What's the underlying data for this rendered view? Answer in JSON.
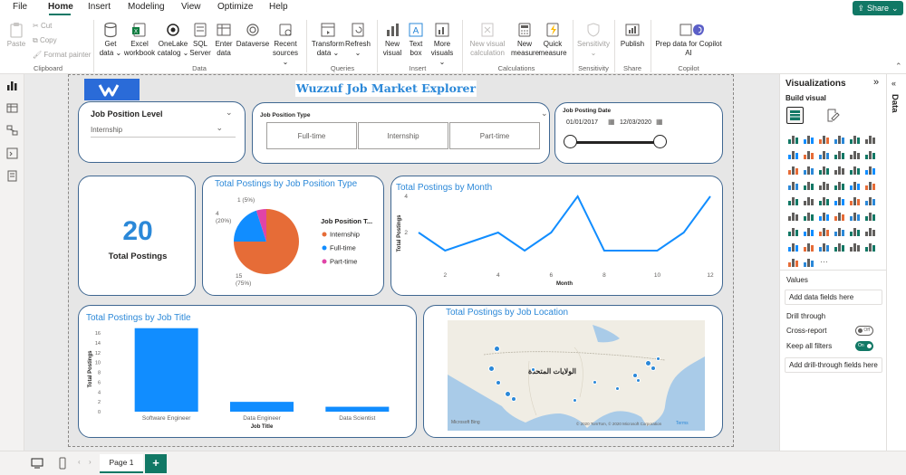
{
  "menu": {
    "file": "File",
    "home": "Home",
    "insert": "Insert",
    "modeling": "Modeling",
    "view": "View",
    "optimize": "Optimize",
    "help": "Help",
    "share": "Share"
  },
  "ribbon": {
    "paste": "Paste",
    "cut": "Cut",
    "copy": "Copy",
    "format_painter": "Format painter",
    "clipboard": "Clipboard",
    "get_data_1": "Get",
    "get_data_2": "data",
    "excel_1": "Excel",
    "excel_2": "workbook",
    "onelake_1": "OneLake",
    "onelake_2": "catalog",
    "sql_1": "SQL",
    "sql_2": "Server",
    "enter_1": "Enter",
    "enter_2": "data",
    "dataverse": "Dataverse",
    "recent_1": "Recent",
    "recent_2": "sources",
    "data": "Data",
    "transform_1": "Transform",
    "transform_2": "data",
    "refresh": "Refresh",
    "queries": "Queries",
    "new_visual_1": "New",
    "new_visual_2": "visual",
    "text_box_1": "Text",
    "text_box_2": "box",
    "more_visuals_1": "More",
    "more_visuals_2": "visuals",
    "insert": "Insert",
    "new_visual_calc_1": "New visual",
    "new_visual_calc_2": "calculation",
    "new_measure_1": "New",
    "new_measure_2": "measure",
    "quick_measure_1": "Quick",
    "quick_measure_2": "measure",
    "calculations": "Calculations",
    "sensitivity_btn": "Sensitivity",
    "sensitivity": "Sensitivity",
    "publish": "Publish",
    "share": "Share",
    "copilot_1": "Prep data for Copilot",
    "copilot_2": "AI",
    "copilot": "Copilot"
  },
  "report": {
    "title": "Wuzzuf Job Market Explorer",
    "slicer_level_label": "Job Position Level",
    "slicer_level_value": "Internship",
    "slicer_type_label": "Job Position Type",
    "slicer_type_options": [
      "Full-time",
      "Internship",
      "Part-time"
    ],
    "slicer_date_label": "Job Posting Date",
    "date_start": "01/01/2017",
    "date_end": "12/03/2020",
    "kpi_value": "20",
    "kpi_label": "Total Postings"
  },
  "chart_data": [
    {
      "type": "pie",
      "title": "Total Postings by Job Position Type",
      "legend_title": "Job Position T...",
      "categories": [
        "Internship",
        "Full-time",
        "Part-time"
      ],
      "values": [
        15,
        4,
        1
      ],
      "labels": [
        "15\n(75%)",
        "4\n(20%)",
        "1 (5%)"
      ],
      "colors": [
        "#e66c37",
        "#118dff",
        "#e044a7"
      ],
      "legend": "right"
    },
    {
      "type": "line",
      "title": "Total Postings by Month",
      "xlabel": "Month",
      "ylabel": "Total Postings",
      "x": [
        1,
        2,
        3,
        4,
        5,
        6,
        7,
        8,
        9,
        10,
        11,
        12
      ],
      "values": [
        2,
        1,
        1.5,
        2,
        1,
        2,
        4,
        1,
        1,
        1,
        2,
        4
      ],
      "xticks": [
        "2",
        "4",
        "6",
        "8",
        "10",
        "12"
      ],
      "yticks": [
        "2",
        "4"
      ],
      "ylim": [
        0,
        4.2
      ],
      "color": "#118dff"
    },
    {
      "type": "bar",
      "title": "Total Postings by Job Title",
      "xlabel": "Job Title",
      "ylabel": "Total Postings",
      "categories": [
        "Software Engineer",
        "Data Engineer",
        "Data Scientist"
      ],
      "values": [
        17,
        2,
        1
      ],
      "yticks": [
        "0",
        "2",
        "4",
        "6",
        "8",
        "10",
        "12",
        "14",
        "16"
      ],
      "ylim": [
        0,
        17.5
      ],
      "color": "#118dff"
    }
  ],
  "map": {
    "title": "Total Postings by Job Location",
    "country_label": "الولايات المتحدة",
    "bing": "Microsoft Bing",
    "copyright": "© 2020 TomTom, © 2020 Microsoft Corporation",
    "terms": "Terms"
  },
  "viz": {
    "title": "Visualizations",
    "build_visual": "Build visual",
    "values": "Values",
    "add_data_fields": "Add data fields here",
    "drill_through": "Drill through",
    "cross_report": "Cross-report",
    "cross_report_state": "Off",
    "keep_filters": "Keep all filters",
    "keep_filters_state": "On",
    "add_drill": "Add drill-through fields here",
    "data_tab": "Data"
  },
  "bottom": {
    "page1": "Page 1",
    "add": "+"
  }
}
